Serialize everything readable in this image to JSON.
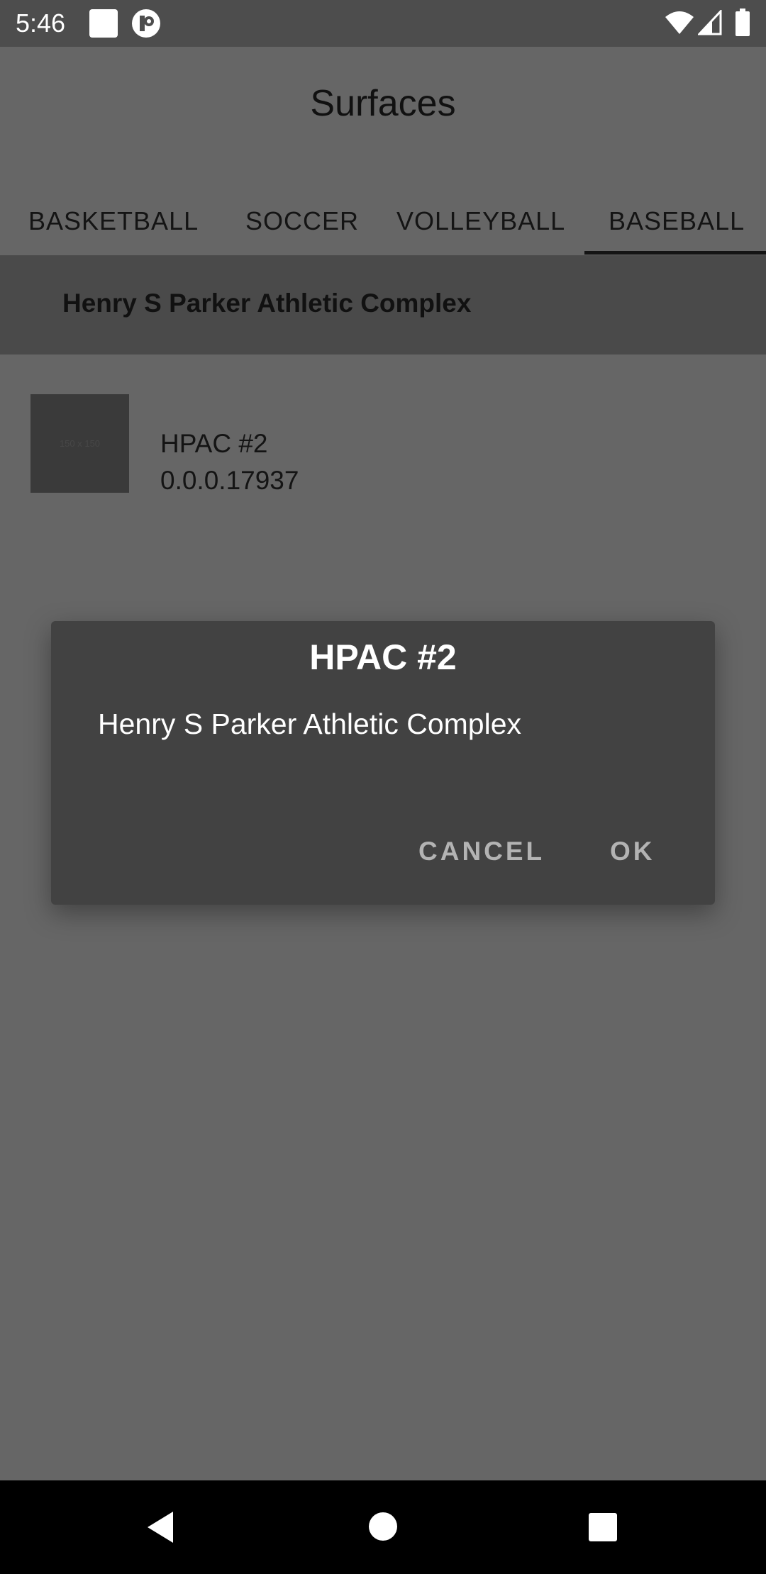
{
  "status_bar": {
    "time": "5:46"
  },
  "app": {
    "title": "Surfaces"
  },
  "tabs": [
    {
      "label": "BASKETBALL",
      "selected": false
    },
    {
      "label": "SOCCER",
      "selected": false
    },
    {
      "label": "VOLLEYBALL",
      "selected": false
    },
    {
      "label": "BASEBALL",
      "selected": true
    }
  ],
  "section": {
    "title": "Henry S Parker Athletic Complex"
  },
  "list": [
    {
      "title": "HPAC #2",
      "subtitle": "0.0.0.17937",
      "thumbnail_text": "150 x 150"
    }
  ],
  "dialog": {
    "title": "HPAC #2",
    "message": "Henry S Parker Athletic Complex",
    "cancel_label": "CANCEL",
    "ok_label": "OK"
  },
  "colors": {
    "scrim_background": "#666666",
    "dialog_background": "#424242",
    "dialog_button_text": "#b3b3b3",
    "navbar": "#000000"
  }
}
